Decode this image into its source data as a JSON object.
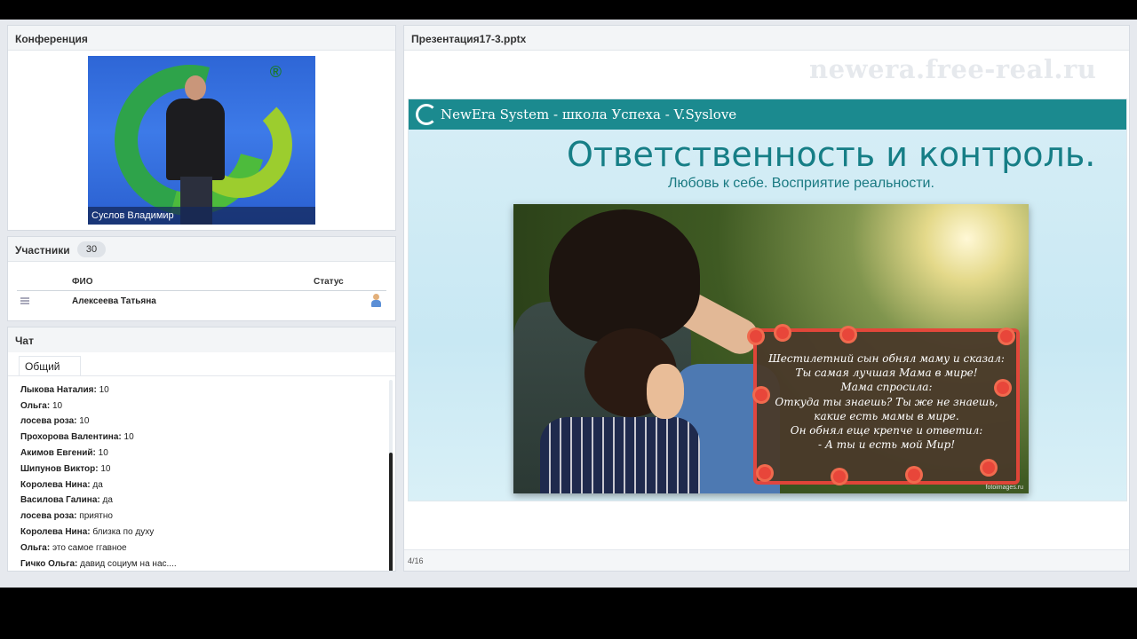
{
  "conference": {
    "title": "Конференция",
    "video_caption": "Суслов Владимир",
    "logo_mark": "®"
  },
  "participants": {
    "title": "Участники",
    "count": "30",
    "col_name": "ФИО",
    "col_status": "Статус",
    "rows": [
      {
        "name": "Алексеева Татьяна",
        "status_icon": "user-icon"
      }
    ]
  },
  "chat": {
    "title": "Чат",
    "tab": "Общий",
    "messages": [
      {
        "author": "Василова Галина:",
        "text": " 10"
      },
      {
        "author": "Лыкова Наталия:",
        "text": " 10"
      },
      {
        "author": "Ольга:",
        "text": " 10"
      },
      {
        "author": "лосева  роза:",
        "text": " 10"
      },
      {
        "author": "Прохорова Валентина:",
        "text": " 10"
      },
      {
        "author": "Акимов  Евгений:",
        "text": " 10"
      },
      {
        "author": "Шипунов Виктор:",
        "text": " 10"
      },
      {
        "author": "Королева Нина:",
        "text": " да"
      },
      {
        "author": "Василова Галина:",
        "text": " да"
      },
      {
        "author": "лосева  роза:",
        "text": " приятно"
      },
      {
        "author": "Королева Нина:",
        "text": " близка по духу"
      },
      {
        "author": "Ольга:",
        "text": " это самое ггавное"
      },
      {
        "author": "Гичко Ольга:",
        "text": " давид социум на нас...."
      }
    ]
  },
  "presentation": {
    "title": "Презентация17-3.pptx",
    "watermark": "newera.free-real.ru",
    "page": "4/16",
    "slide": {
      "header": "NewEra System - школа Успеха - V.Syslove",
      "title": "Ответственность и контроль.",
      "subtitle": "Любовь к себе. Восприятие реальности.",
      "poem": [
        "Шестилетний сын обнял маму и сказал:",
        "Ты самая лучшая Мама в мире!",
        "Мама спросила:",
        "Откуда ты знаешь? Ты же не знаешь,",
        "какие есть мамы в мире.",
        "Он обнял еще крепче и ответил:",
        "- А ты и есть мой Мир!"
      ],
      "photo_credit": "fotoimages.ru",
      "accent_color": "#1b8a8f"
    }
  }
}
